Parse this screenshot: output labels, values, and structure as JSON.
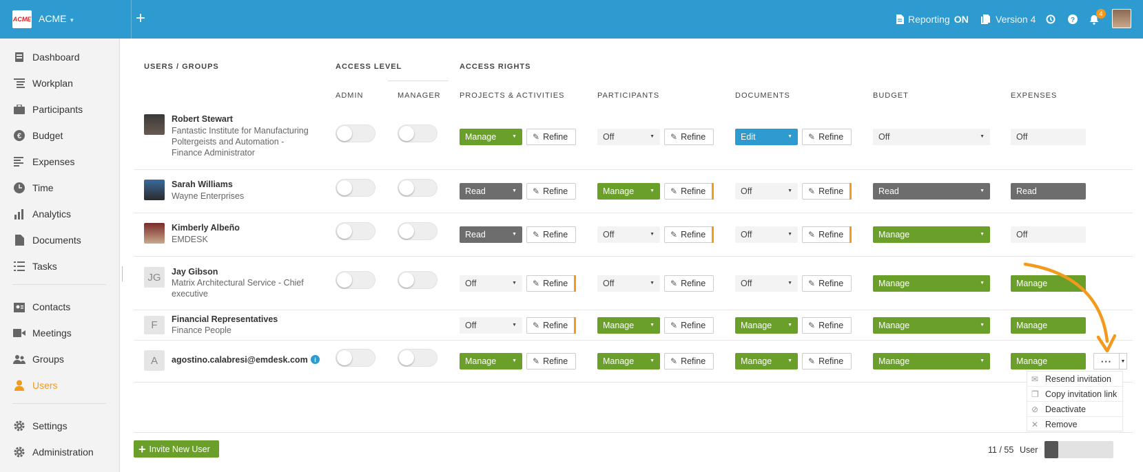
{
  "header": {
    "brand": "ACME",
    "logo_text": "ACME",
    "reporting_label": "Reporting",
    "reporting_state": "ON",
    "version_label": "Version 4",
    "notification_count": "4",
    "icons": [
      "plus-icon",
      "document-icon",
      "copy-icon",
      "history-icon",
      "help-icon",
      "bell-icon"
    ]
  },
  "sidebar": {
    "items": [
      {
        "label": "Dashboard",
        "icon": "dashboard-icon"
      },
      {
        "label": "Workplan",
        "icon": "workplan-icon"
      },
      {
        "label": "Participants",
        "icon": "briefcase-icon"
      },
      {
        "label": "Budget",
        "icon": "euro-icon"
      },
      {
        "label": "Expenses",
        "icon": "expenses-icon"
      },
      {
        "label": "Time",
        "icon": "clock-icon"
      },
      {
        "label": "Analytics",
        "icon": "bar-chart-icon"
      },
      {
        "label": "Documents",
        "icon": "document-icon"
      },
      {
        "label": "Tasks",
        "icon": "list-icon"
      },
      {
        "label": "Contacts",
        "icon": "contacts-icon"
      },
      {
        "label": "Meetings",
        "icon": "video-icon"
      },
      {
        "label": "Groups",
        "icon": "group-icon"
      },
      {
        "label": "Users",
        "icon": "user-icon",
        "active": true
      },
      {
        "label": "Settings",
        "icon": "gear-icon"
      },
      {
        "label": "Administration",
        "icon": "gear-icon"
      }
    ]
  },
  "table": {
    "headers": {
      "users_groups": "USERS / GROUPS",
      "access_level": "ACCESS LEVEL",
      "access_rights": "ACCESS RIGHTS",
      "admin": "ADMIN",
      "manager": "MANAGER",
      "projects": "PROJECTS & ACTIVITIES",
      "participants": "PARTICIPANTS",
      "documents": "DOCUMENTS",
      "budget": "BUDGET",
      "expenses": "EXPENSES"
    },
    "refine_label": "Refine",
    "rows": [
      {
        "name": "Robert Stewart",
        "sub1": "Fantastic Institute for Manufacturing",
        "sub2": "Poltergeists and Automation -",
        "sub3": "Finance Administrator",
        "projects": "Manage",
        "participants": "Off",
        "documents": "Edit",
        "budget": "Off",
        "expenses": "Off"
      },
      {
        "name": "Sarah Williams",
        "sub1": "Wayne Enterprises",
        "projects": "Read",
        "participants": "Manage",
        "documents": "Off",
        "budget": "Read",
        "expenses": "Read"
      },
      {
        "name": "Kimberly Albeño",
        "sub1": "EMDESK",
        "projects": "Read",
        "participants": "Off",
        "documents": "Off",
        "budget": "Manage",
        "expenses": "Off"
      },
      {
        "name": "Jay Gibson",
        "initials": "JG",
        "sub1": "Matrix Architectural Service - Chief",
        "sub2": "executive",
        "projects": "Off",
        "participants": "Off",
        "documents": "Off",
        "budget": "Manage",
        "expenses": "Manage"
      },
      {
        "name": "Financial Representatives",
        "initials": "F",
        "sub1": "Finance People",
        "projects": "Off",
        "participants": "Manage",
        "documents": "Manage",
        "budget": "Manage",
        "expenses": "Manage"
      },
      {
        "name": "agostino.calabresi@emdesk.com",
        "initials": "A",
        "projects": "Manage",
        "participants": "Manage",
        "documents": "Manage",
        "budget": "Manage",
        "expenses": "Manage"
      }
    ]
  },
  "row_menu": {
    "dots_label": "···",
    "items": [
      "Resend invitation",
      "Copy invitation link",
      "Deactivate",
      "Remove"
    ]
  },
  "footer": {
    "invite_label": "Invite New User",
    "count": "11 / 55",
    "user_label": "User"
  },
  "colors": {
    "header": "#2e9bd0",
    "manage": "#6aa02a",
    "read": "#6d6d6d",
    "edit": "#2e9bd0",
    "accent": "#f39a1d"
  }
}
